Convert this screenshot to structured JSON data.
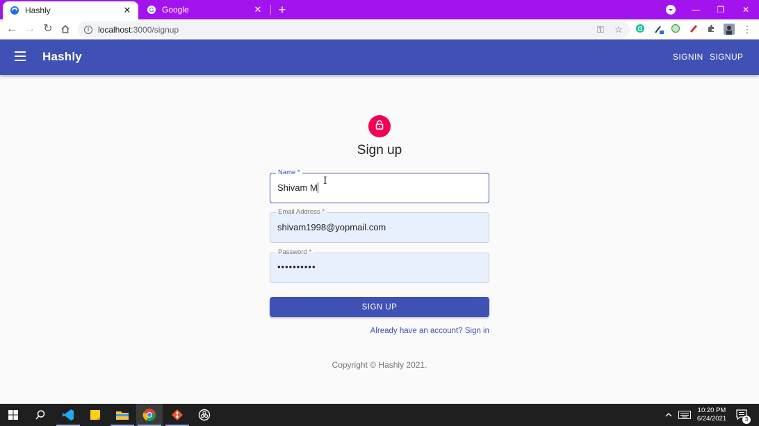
{
  "browser": {
    "tabs": [
      {
        "title": "Hashly",
        "favicon": "hashly-logo-icon",
        "active": true
      },
      {
        "title": "Google",
        "favicon": "google-g-icon",
        "active": false
      }
    ],
    "url_host": "localhost",
    "url_path": ":3000/signup",
    "new_tab": "+",
    "window_minimize": "—",
    "window_restore": "❐",
    "window_close": "✕"
  },
  "appbar": {
    "title": "Hashly",
    "links": [
      "SIGNIN",
      "SIGNUP"
    ],
    "color": "#3f51b5"
  },
  "form": {
    "heading": "Sign up",
    "avatar_icon": "lock-open-icon",
    "avatar_color": "#f50057",
    "fields": [
      {
        "label": "Name *",
        "value": "Shivam M",
        "state": "focused"
      },
      {
        "label": "Email Address *",
        "value": "shivam1998@yopmail.com",
        "state": "autofilled"
      },
      {
        "label": "Password *",
        "value": "••••••••••",
        "state": "autofilled"
      }
    ],
    "submit_label": "SIGN UP",
    "signin_link": "Already have an account? Sign in"
  },
  "footer": {
    "copyright": "Copyright © Hashly 2021."
  },
  "taskbar": {
    "apps": [
      "start-icon",
      "search-icon",
      "vscode-icon",
      "sticky-notes-icon",
      "file-explorer-icon",
      "chrome-icon",
      "git-icon",
      "obs-icon"
    ],
    "time": "10:20 PM",
    "date": "6/24/2021",
    "notifications": "3"
  }
}
